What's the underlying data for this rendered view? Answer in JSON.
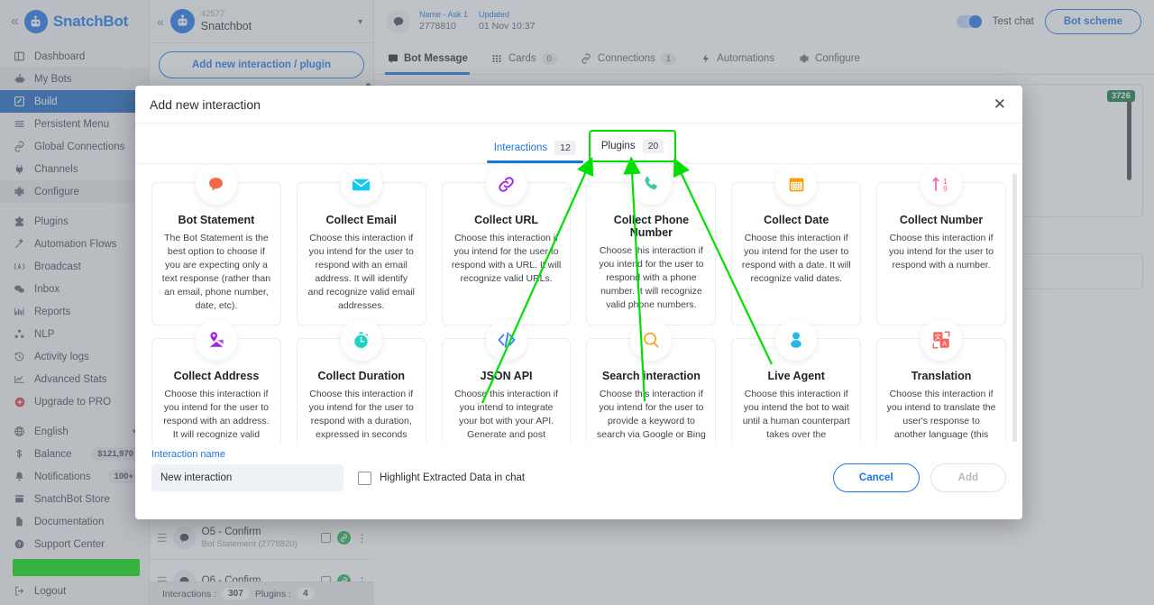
{
  "brand": {
    "name": "SnatchBot",
    "collapse_icon": "double-chevron-left-icon",
    "logo_icon": "snatchbot-robot-logo"
  },
  "sidebar": {
    "items": [
      {
        "label": "Dashboard",
        "icon": "dashboard-icon"
      },
      {
        "label": "My Bots",
        "icon": "robot-icon"
      },
      {
        "label": "Build",
        "icon": "pencil-icon"
      },
      {
        "label": "Persistent Menu",
        "icon": "menu-lines-icon"
      },
      {
        "label": "Global Connections",
        "icon": "link-icon"
      },
      {
        "label": "Channels",
        "icon": "plug-icon"
      },
      {
        "label": "Configure",
        "icon": "gear-icon"
      },
      {
        "label": "Plugins",
        "icon": "puzzle-icon"
      },
      {
        "label": "Automation Flows",
        "icon": "magic-wand-icon"
      },
      {
        "label": "Broadcast",
        "icon": "broadcast-icon"
      },
      {
        "label": "Inbox",
        "icon": "chat-bubbles-icon"
      },
      {
        "label": "Reports",
        "icon": "bar-chart-icon"
      },
      {
        "label": "NLP",
        "icon": "nodes-icon"
      },
      {
        "label": "Activity logs",
        "icon": "history-clock-icon"
      },
      {
        "label": "Advanced Stats",
        "icon": "line-chart-icon"
      },
      {
        "label": "Upgrade to PRO",
        "icon": "red-gear-plus-icon"
      },
      {
        "label": "English",
        "icon": "globe-icon",
        "caret": "chevron-down-icon"
      },
      {
        "label": "Balance",
        "icon": "dollar-icon",
        "badge": "$121,970"
      },
      {
        "label": "Notifications",
        "icon": "bell-icon",
        "badge": "100+"
      },
      {
        "label": "SnatchBot Store",
        "icon": "store-icon"
      },
      {
        "label": "Documentation",
        "icon": "document-icon"
      },
      {
        "label": "Support Center",
        "icon": "question-circle-icon"
      },
      {
        "label": "Logout",
        "icon": "logout-icon"
      }
    ],
    "active_label": "Build",
    "highlight_color": "#00e000"
  },
  "interactions_panel": {
    "collapse_icon": "double-chevron-left-icon",
    "bot_id": "42577",
    "bot_name": "Snatchbot",
    "add_button": "Add new interaction / plugin",
    "rows": [
      {
        "title": "O5 - Confirm",
        "subtitle": "Bot Statement (2778820)"
      },
      {
        "title": "O6 - Confirm",
        "subtitle": ""
      }
    ],
    "footer": {
      "interactions_label": "Interactions :",
      "interactions_value": "307",
      "plugins_label": "Plugins :",
      "plugins_value": "4"
    }
  },
  "main": {
    "header": {
      "icon": "chat-bubble-icon",
      "name_key": "Name - Ask 1",
      "name_value": "2778810",
      "updated_key": "Updated",
      "updated_value": "01 Nov 10:37",
      "test_chat_label": "Test chat",
      "bot_scheme_label": "Bot scheme"
    },
    "tabs": [
      {
        "label": "Bot Message",
        "icon": "bot-message-icon",
        "count": ""
      },
      {
        "label": "Cards",
        "icon": "cards-grid-icon",
        "count": "0"
      },
      {
        "label": "Connections",
        "icon": "link-icon",
        "count": "1"
      },
      {
        "label": "Automations",
        "icon": "lightning-icon",
        "count": ""
      },
      {
        "label": "Configure",
        "icon": "gear-icon",
        "count": ""
      }
    ],
    "active_tab": "Bot Message",
    "message_badge": "3726"
  },
  "modal": {
    "title": "Add new interaction",
    "close_icon": "close-x-icon",
    "tabs": [
      {
        "label": "Interactions",
        "count": "12",
        "selected": true,
        "highlighted": false
      },
      {
        "label": "Plugins",
        "count": "20",
        "selected": false,
        "highlighted": true
      }
    ],
    "cards": [
      {
        "title": "Bot Statement",
        "desc": "The Bot Statement is the best option to choose if you are expecting only a text response (rather than an email, phone number, date, etc).",
        "icon": "speech-bubble-icon",
        "color": "#f4684a"
      },
      {
        "title": "Collect Email",
        "desc": "Choose this interaction if you intend for the user to respond with an email address. It will identify and recognize valid email addresses.",
        "icon": "envelope-icon",
        "color": "#0fc9f5"
      },
      {
        "title": "Collect URL",
        "desc": "Choose this interaction if you intend for the user to respond with a URL. It will recognize valid URLs.",
        "icon": "chain-link-icon",
        "color": "#a322e8"
      },
      {
        "title": "Collect Phone Number",
        "desc": "Choose this interaction if you intend for the user to respond with a phone number. It will recognize valid phone numbers.",
        "icon": "phone-handset-icon",
        "color": "#3fc8a8"
      },
      {
        "title": "Collect Date",
        "desc": "Choose this interaction if you intend for the user to respond with a date. It will recognize valid dates.",
        "icon": "calendar-icon",
        "color": "#f59f0b"
      },
      {
        "title": "Collect Number",
        "desc": "Choose this interaction if you intend for the user to respond with a number.",
        "icon": "number-arrow-icon",
        "color": "#f461a8"
      },
      {
        "title": "Collect Address",
        "desc": "Choose this interaction if you intend for the user to respond with an address. It will recognize valid addresses.",
        "icon": "map-pin-icon",
        "color": "#a322e8"
      },
      {
        "title": "Collect Duration",
        "desc": "Choose this interaction if you intend for the user to respond with a duration, expressed in seconds and milliseconds.",
        "icon": "stopwatch-icon",
        "color": "#1fd3c4"
      },
      {
        "title": "JSON API",
        "desc": "Choose this interaction if you intend to integrate your bot with your API. Generate and post custom content in chat.",
        "icon": "code-brackets-icon",
        "color": "#3b82f6"
      },
      {
        "title": "Search interaction",
        "desc": "Choose this interaction if you intend for the user to provide a keyword to search via Google or Bing search engines (this interaction uses Microsoft Bing API and Google Search API).",
        "icon": "magnifier-icon",
        "color": "#f5a623"
      },
      {
        "title": "Live Agent",
        "desc": "Choose this interaction if you intend the bot to wait until a human counterpart takes over the conversation.",
        "icon": "person-circle-icon",
        "color": "#22b8e8"
      },
      {
        "title": "Translation",
        "desc": "Choose this interaction if you intend to translate the user's response to another language (this interaction uses the Microsoft translation API).",
        "icon": "translate-icon",
        "color": "#f4675f"
      }
    ],
    "footer": {
      "name_label": "Interaction name",
      "name_value": "New interaction",
      "name_placeholder": "Interaction name",
      "checkbox_label": "Highlight Extracted Data in chat",
      "checkbox_checked": false,
      "cancel_label": "Cancel",
      "add_label": "Add"
    }
  },
  "annotation": {
    "arrow_color": "#00e000",
    "arrow_count": 3
  }
}
